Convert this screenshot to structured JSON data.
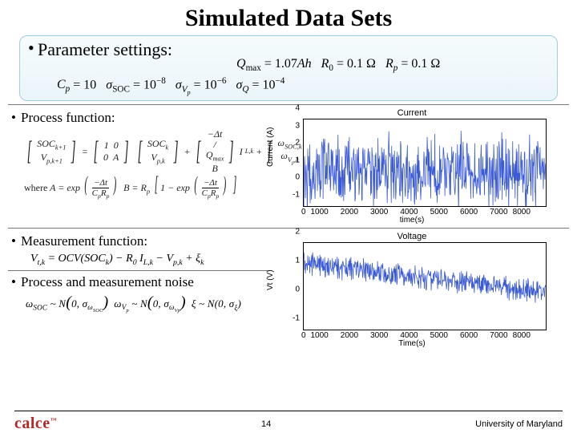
{
  "title": "Simulated Data Sets",
  "sections": {
    "params": {
      "heading": "Parameter settings:",
      "line1": "Q_max = 1.07 Ah   R_0 = 0.1 Ω   R_p = 0.1 Ω",
      "line2": "C_p = 10   σ_SOC = 10^-8   σ_Vp = 10^-6   σ_Q = 10^-4"
    },
    "process": {
      "heading": "Process function:",
      "eq_top_left": "SOC_{k+1}",
      "eq_bot_left": "V_{p,k+1}",
      "mat1": "1 0 ; 0 A",
      "vec1": "SOC_k ; V_{p,k}",
      "mat2": "−Δt / Q_max ; B",
      "scalar": "I_{L,k}",
      "vec2": "ω_{SOC,k} ; ω_{Vp,k}",
      "where_label": "where",
      "A_def": "A = exp(−Δt / (C_p R_p))",
      "B_def": "B = R_p [1 − exp(−Δt / (C_p R_p))]"
    },
    "measurement": {
      "heading": "Measurement function:",
      "eq": "V_{t,k} = OCV(SOC_k) − R_0 I_{L,k} − V_{p,k} + ξ_k"
    },
    "noise": {
      "heading": "Process and measurement noise",
      "eq": "ω_SOC ~ N(0, σ_{ω_SOC})   ω_Vp ~ N(0, σ_{ω_Vp})   ξ ~ N(0, σ_ξ)"
    }
  },
  "footer": {
    "logo": "calce",
    "page": "14",
    "org": "University of Maryland"
  },
  "chart_data": [
    {
      "type": "line",
      "title": "Current",
      "xlabel": "time(s)",
      "ylabel": "Current (A)",
      "xlim": [
        0,
        8000
      ],
      "ylim": [
        -1,
        4
      ],
      "xticks": [
        0,
        1000,
        2000,
        3000,
        4000,
        5000,
        6000,
        7000,
        8000
      ],
      "yticks": [
        -1,
        0,
        1,
        2,
        3,
        4
      ],
      "series": [
        {
          "name": "current",
          "color": "#3b5bd6",
          "description": "noisy current signal, mean ~1A, fluctuating roughly between -0.5 and 3 A across 0–8000 s",
          "approx_mean": 1.0,
          "approx_range": [
            -0.5,
            3.0
          ]
        }
      ]
    },
    {
      "type": "line",
      "title": "Voltage",
      "xlabel": "Time(s)",
      "ylabel": "Vt (V)",
      "xlim": [
        0,
        8000
      ],
      "ylim": [
        -1,
        2
      ],
      "xticks": [
        0,
        1000,
        2000,
        3000,
        4000,
        5000,
        6000,
        7000,
        8000
      ],
      "yticks": [
        -1,
        0,
        1,
        2
      ],
      "series": [
        {
          "name": "voltage",
          "color": "#3b5bd6",
          "description": "noisy voltage signal decaying roughly linearly from ~1.3 V at t=0 to ~0.3 V at t=8000, with noise amplitude ~0.3 V",
          "trend_start": 1.3,
          "trend_end": 0.3
        }
      ]
    }
  ]
}
